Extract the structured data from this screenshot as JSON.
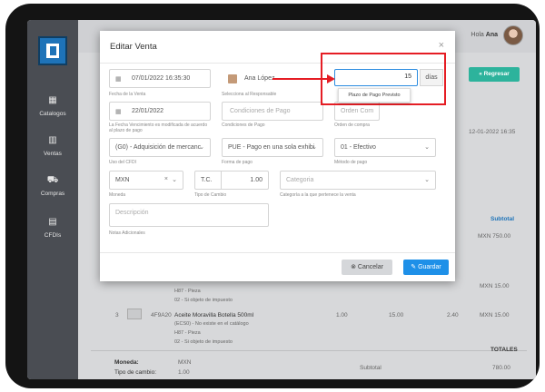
{
  "header": {
    "greeting": "Hola",
    "user": "Ana"
  },
  "sidebar": {
    "items": [
      {
        "label": "Catalogos",
        "icon": "grid-icon"
      },
      {
        "label": "Ventas",
        "icon": "chart-icon"
      },
      {
        "label": "Compras",
        "icon": "cart-icon"
      },
      {
        "label": "CFDIs",
        "icon": "document-icon"
      }
    ]
  },
  "regresar_label": "Regresar",
  "background": {
    "fecha": "12-01-2022 16:35",
    "subtotal_header": "Subtotal",
    "row1_total": "MXN 750.00",
    "row2_total": "MXN 15.00",
    "row2_iva": "H87 - Pieza",
    "row2_obj": "02 - Si objeto de impuesto",
    "row3_num": "3",
    "row3_code": "4F9A20",
    "row3_desc": "Aceite Moravilla Botella 500ml",
    "row3_sub": "(ECS0) - No existe en el catálogo",
    "row3_unit": "H87 - Pieza",
    "row3_obj": "02 - Si objeto de impuesto",
    "row3_qty": "1.00",
    "row3_price": "15.00",
    "row3_tax": "2.40",
    "row3_total": "MXN 15.00",
    "totales": "TOTALES",
    "moneda_label": "Moneda:",
    "moneda_value": "MXN",
    "tipo_cambio_label": "Tipo de cambio:",
    "tipo_cambio_value": "1.00",
    "subtotal_label": "Subtotal",
    "subtotal_value": "780.00"
  },
  "modal": {
    "title": "Editar Venta",
    "fecha_venta": "07/01/2022 16:35:30",
    "fecha_venta_caption": "Fecha de la Venta",
    "responsable": "Ana López",
    "responsable_caption": "Selecciona al Responsable",
    "fecha_pago": "22/01/2022",
    "fecha_pago_caption": "La Fecha Vencimiento es modificada de acuerdo al plazo de pago",
    "condiciones_placeholder": "Condiciones de Pago",
    "condiciones_caption": "Condiciones de Pago",
    "orden_compra_placeholder": "Orden Com",
    "orden_compra_caption": "Orden de compra",
    "uso_cfdi": "(G0) - Adquisición de mercanc",
    "uso_cfdi_caption": "Uso del CFDI",
    "forma_pago": "PUE - Pago en una sola exhibi",
    "forma_pago_caption": "Forma de pago",
    "metodo_pago": "01 - Efectivo",
    "metodo_pago_caption": "Método de pago",
    "moneda": "MXN",
    "moneda_caption": "Moneda",
    "tc_label": "T.C.",
    "tc_value": "1.00",
    "tc_caption": "Tipo de Cambio",
    "categoria_placeholder": "Categoria",
    "categoria_caption": "Categoría a la que pertenece la venta",
    "descripcion_placeholder": "Descripción",
    "descripcion_caption": "Notas Adicionales",
    "dias_value": "15",
    "dias_label": "días",
    "tooltip": "Plazo de Pago Previsto",
    "cancel_label": "Cancelar",
    "save_label": "Guardar"
  },
  "colors": {
    "highlight": "#e51d24",
    "primary": "#1e90e8",
    "success": "#2db39c"
  }
}
